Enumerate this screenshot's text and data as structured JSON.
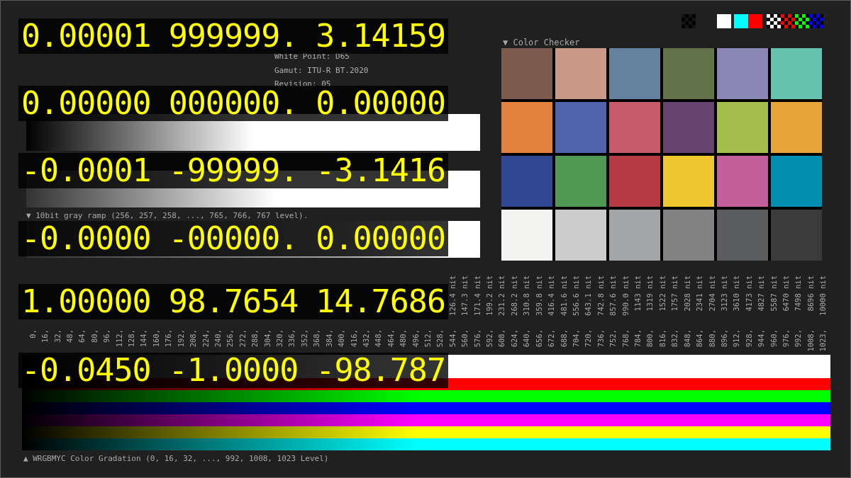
{
  "information": {
    "lines": [
      "White Point: D65",
      "Gamut: ITU-R BT.2020",
      "Revision: 05"
    ]
  },
  "ramps": [
    {
      "kind": "full"
    },
    {
      "kind": "mid"
    },
    {
      "kind": "mid_fine",
      "label": "▼ 10bit gray ramp (256, 257, 258, ..., 765, 766, 767 level)."
    }
  ],
  "patterns": [
    {
      "kind": "checker",
      "color": "#141414"
    },
    {
      "kind": "solid",
      "color": "#ffffff"
    },
    {
      "kind": "solid",
      "color": "#00ffff"
    },
    {
      "kind": "solid",
      "color": "#ff0000"
    },
    {
      "kind": "checker",
      "color": "#ffffff"
    },
    {
      "kind": "checker",
      "color": "#ff0000"
    },
    {
      "kind": "checker",
      "color": "#00ff00"
    },
    {
      "kind": "checker",
      "color": "#0000ff"
    }
  ],
  "color_checker": {
    "title": "▼ Color Checker",
    "patches": [
      {
        "color": "#7d5a4e"
      },
      {
        "color": "#cb9987"
      },
      {
        "color": "#6482a0"
      },
      {
        "color": "#62734a"
      },
      {
        "color": "#8a87b5"
      },
      {
        "color": "#64c2ae"
      },
      {
        "color": "#e2823e"
      },
      {
        "color": "#4f64ad"
      },
      {
        "color": "#c85b69"
      },
      {
        "color": "#674370"
      },
      {
        "color": "#a4be4c"
      },
      {
        "color": "#e6a43a"
      },
      {
        "color": "#304894"
      },
      {
        "color": "#4f9955"
      },
      {
        "color": "#b53a44"
      },
      {
        "color": "#eec72e"
      },
      {
        "color": "#c35e9a"
      },
      {
        "color": "#008fb0"
      },
      {
        "color": "#f4f5f2"
      },
      {
        "color": "#cbcccb"
      },
      {
        "color": "#a5a6a7"
      },
      {
        "color": "#818181"
      },
      {
        "color": "#5c5d5e"
      },
      {
        "color": "#3b3b3c"
      }
    ]
  },
  "luminance_labels": [
    {
      "code": "0,"
    },
    {
      "code": "16,"
    },
    {
      "code": "32,"
    },
    {
      "code": "48,"
    },
    {
      "code": "64,"
    },
    {
      "code": "80,"
    },
    {
      "code": "96,"
    },
    {
      "code": "112,"
    },
    {
      "code": "128,"
    },
    {
      "code": "144,"
    },
    {
      "code": "160,"
    },
    {
      "code": "176,"
    },
    {
      "code": "192,"
    },
    {
      "code": "208,"
    },
    {
      "code": "224,"
    },
    {
      "code": "240,"
    },
    {
      "code": "256,"
    },
    {
      "code": "272,"
    },
    {
      "code": "288,"
    },
    {
      "code": "304,"
    },
    {
      "code": "320,"
    },
    {
      "code": "336,"
    },
    {
      "code": "352,"
    },
    {
      "code": "368,"
    },
    {
      "code": "384,"
    },
    {
      "code": "400,"
    },
    {
      "code": "416,"
    },
    {
      "code": "432,"
    },
    {
      "code": "448,"
    },
    {
      "code": "464,"
    },
    {
      "code": "480,"
    },
    {
      "code": "496,"
    },
    {
      "code": "512,"
    },
    {
      "code": "528,"
    },
    {
      "code": "544,",
      "luminance": "126.4 nit"
    },
    {
      "code": "560,",
      "luminance": "147.3 nit"
    },
    {
      "code": "576,",
      "luminance": "171.4 nit"
    },
    {
      "code": "592,",
      "luminance": "199.2 nit"
    },
    {
      "code": "608,",
      "luminance": "231.2 nit"
    },
    {
      "code": "624,",
      "luminance": "268.2 nit"
    },
    {
      "code": "640,",
      "luminance": "310.8 nit"
    },
    {
      "code": "656,",
      "luminance": "359.8 nit"
    },
    {
      "code": "672,",
      "luminance": "416.4 nit"
    },
    {
      "code": "688,",
      "luminance": "481.6 nit"
    },
    {
      "code": "704,",
      "luminance": "556.6 nit"
    },
    {
      "code": "720,",
      "luminance": "643.1 nit"
    },
    {
      "code": "736,",
      "luminance": "742.8 nit"
    },
    {
      "code": "752,",
      "luminance": "857.6 nit"
    },
    {
      "code": "768,",
      "luminance": "990.0 nit"
    },
    {
      "code": "784,",
      "luminance": "1143 nit"
    },
    {
      "code": "800,",
      "luminance": "1319 nit"
    },
    {
      "code": "816,",
      "luminance": "1522 nit"
    },
    {
      "code": "832,",
      "luminance": "1757 nit"
    },
    {
      "code": "848,",
      "luminance": "2028 nit"
    },
    {
      "code": "864,",
      "luminance": "2341 nit"
    },
    {
      "code": "880,",
      "luminance": "2704 nit"
    },
    {
      "code": "896,",
      "luminance": "3123 nit"
    },
    {
      "code": "912,",
      "luminance": "3610 nit"
    },
    {
      "code": "928,",
      "luminance": "4173 nit"
    },
    {
      "code": "944,",
      "luminance": "4827 nit"
    },
    {
      "code": "960,",
      "luminance": "5587 nit"
    },
    {
      "code": "976,",
      "luminance": "6470 nit"
    },
    {
      "code": "992,",
      "luminance": "7498 nit"
    },
    {
      "code": "1008,",
      "luminance": "8696 nit"
    },
    {
      "code": "1023,",
      "luminance": "10000 nit"
    }
  ],
  "gradation": {
    "bars": [
      {
        "color": "#ffffff"
      },
      {
        "color": "#ff0000"
      },
      {
        "color": "#00ff00"
      },
      {
        "color": "#0000ff"
      },
      {
        "color": "#ff00ff"
      },
      {
        "color": "#ffff00"
      },
      {
        "color": "#00ffff"
      }
    ],
    "label": "▲ WRGBMYC Color Gradation (0, 16, 32, ..., 992, 1008, 1023 Level)"
  },
  "displays": [
    {
      "readings": [
        "0.00001",
        "999999.",
        "3.14159"
      ]
    },
    {
      "readings": [
        "0.00000",
        "000000.",
        "0.00000"
      ]
    },
    {
      "readings": [
        "-0.0001",
        "-99999.",
        "-3.1416"
      ]
    },
    {
      "readings": [
        "-0.0000",
        "-00000.",
        "0.00000"
      ]
    },
    {
      "readings": [
        "1.00000",
        "98.7654",
        "14.7686"
      ]
    },
    {
      "readings": [
        "-0.0450",
        "-1.0000",
        "-98.787"
      ]
    }
  ]
}
